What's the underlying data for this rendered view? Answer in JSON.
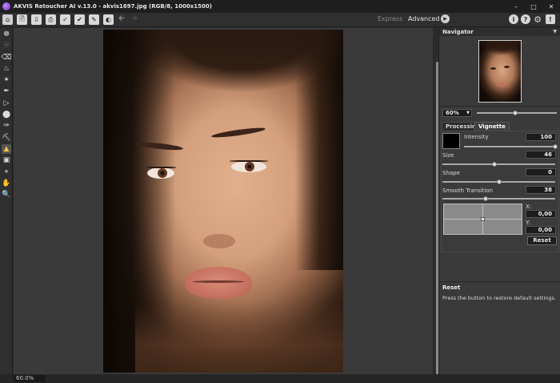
{
  "titlebar": {
    "title": "AKVIS Retoucher AI v.13.0 - akvis1697.jpg (RGB/8, 1000x1500)",
    "controls": [
      "minimize",
      "maximize",
      "close"
    ]
  },
  "toolbar": {
    "mode_express": "Express",
    "mode_advanced": "Advanced",
    "buttons": [
      "home-icon",
      "open-file-icon",
      "save-file-icon",
      "print-icon",
      "preset-brush-icon",
      "preset-check-icon",
      "preset-edit-icon",
      "preset-tone-icon",
      "undo-icon",
      "redo-icon"
    ],
    "right_buttons": [
      "info-icon",
      "help-icon",
      "settings-icon",
      "notifications-icon"
    ]
  },
  "tools": [
    "retouch-brush",
    "selection-shield",
    "eraser",
    "paint-bucket",
    "magic-wand",
    "dropper",
    "polygon-select",
    "blob-tool",
    "color-picker",
    "chisel",
    "clone-stamp",
    "crop",
    "hand",
    "zoom"
  ],
  "status": {
    "zoom": "60.0%"
  },
  "navigator": {
    "title": "Navigator",
    "zoom": "60%",
    "zoom_slider_fraction": 0.48
  },
  "tabs": {
    "processing": "Processing",
    "vignette": "Vignette",
    "active": "vignette"
  },
  "vignette": {
    "color": "#000000",
    "intensity_label": "Intensity",
    "intensity_value": "100",
    "intensity_fraction": 1.0,
    "size_label": "Size",
    "size_value": "46",
    "size_fraction": 0.46,
    "shape_label": "Shape",
    "shape_value": "0",
    "shape_fraction": 0.5,
    "smooth_label": "Smooth Transition",
    "smooth_value": "38",
    "smooth_fraction": 0.38,
    "x_label": "X:",
    "x_value": "0,00",
    "y_label": "Y:",
    "y_value": "0,00",
    "reset_label": "Reset"
  },
  "help": {
    "title": "Reset",
    "text": "Press the button to restore default settings."
  }
}
